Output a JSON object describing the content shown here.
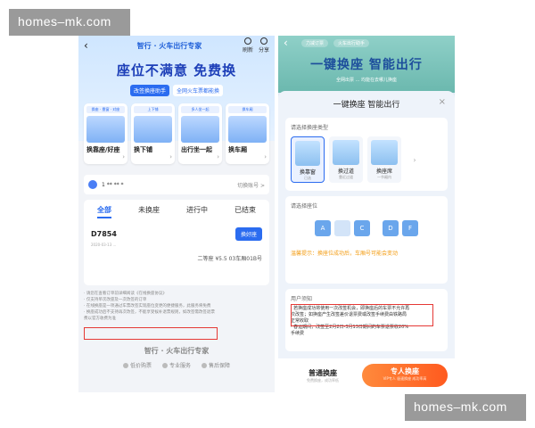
{
  "watermark": {
    "top": "homes–mk.com",
    "bottom": "homes–mk.com"
  },
  "left": {
    "brand": "智行 · 火车出行专家",
    "nav_icons": [
      "刷新",
      "分享"
    ],
    "title": "座位不满意 免费换",
    "sub_pill": "改签换座助手",
    "sub_pill2": "全网火车票都能换",
    "cards": [
      {
        "tag": "换座 · 靠窗 · 对座",
        "label": "换靠座/好座"
      },
      {
        "tag": "上下铺",
        "label": "换下铺"
      },
      {
        "tag": "多人坐一起",
        "label": "出行坐一起"
      },
      {
        "tag": "换车厢",
        "label": "换车厢"
      }
    ],
    "user_mask": "1 ** ** *",
    "user_action": "切换账号 >",
    "tabs": [
      "全部",
      "未换座",
      "进行中",
      "已结束"
    ],
    "train_no": "D7854",
    "swap_btn": "换好座",
    "train_meta": "2020-03-13 ...",
    "seat_info": "二等座 ¥5.5 03车厢01B号",
    "notes": [
      "· 请您在查看订单前详细阅读《在线换座协议》",
      "· 仅支持单次改座及一次改签的订单",
      "· 在线换座是一项通过车票改签实现座位变更的便捷服务，此服务将免费",
      "· 换座成功后不支持再次改签，不能享受候补退票规则，如改签需改签退票",
      "  费以官方收费为准"
    ],
    "footer_brand": "智行 · 火车出行专家",
    "features": [
      "低价购票",
      "专业服务",
      "售后保障"
    ]
  },
  "right": {
    "nav_badge": "力减订票",
    "nav_badge2": "火车出行助手",
    "title": "一键换座 智能出行",
    "sub": "全网出票 ... 均能在去哪儿换座",
    "sheet_title": "一键换座 智能出行",
    "type_label": "请选择换座类型",
    "types": [
      {
        "name": "换靠窗",
        "sm": "已选"
      },
      {
        "name": "换过道",
        "sm": "靠近过道"
      },
      {
        "name": "换座席",
        "sm": "一节厢内"
      }
    ],
    "seat_label": "请选择座位",
    "seat_letters": [
      "A",
      "C",
      "D",
      "F"
    ],
    "tip": "温馨提示：换座位成功后，车厢号可能会变动",
    "notice_label": "用户须知",
    "notice": [
      "· 若换座成功将使用一次改签机会，即换座后的车票不允许再",
      "  次改签；如换座产生改签差价退票费或改签手续费由铁路局",
      "  正常收取",
      "· 春运期间，改签至2月2日-3月13日期间的车票退票收20%",
      "  手续费"
    ],
    "normal_btn": "普通换座",
    "normal_sub": "免费换座，成功率低",
    "vip_btn": "专人换座",
    "vip_sub": "VIP专人 极速换座 成功率高"
  }
}
